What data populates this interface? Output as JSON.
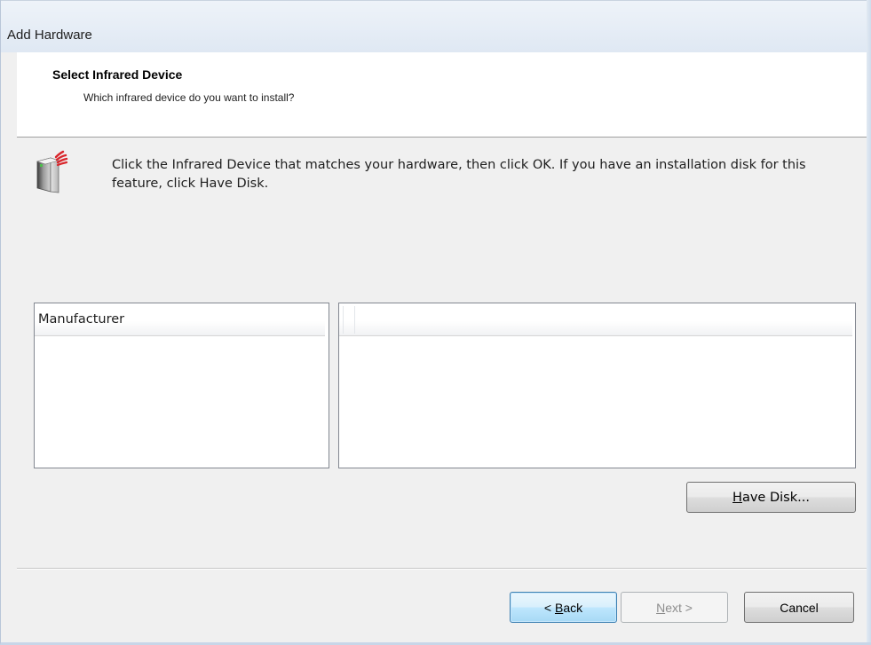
{
  "window": {
    "title": "Add Hardware"
  },
  "header": {
    "title": "Select Infrared Device",
    "subtitle": "Which infrared device do you want to install?"
  },
  "main": {
    "instruction": "Click the Infrared Device that matches your hardware, then click OK. If you have an installation disk for this feature, click Have Disk.",
    "device_icon": "infrared-device-icon",
    "manufacturer_list": {
      "header": "Manufacturer",
      "items": []
    },
    "model_list": {
      "header": "",
      "items": []
    },
    "have_disk": {
      "mnemonic": "H",
      "rest": "ave Disk..."
    }
  },
  "footer": {
    "back": {
      "prefix": "< ",
      "mnemonic": "B",
      "rest": "ack"
    },
    "next": {
      "mnemonic": "N",
      "rest": "ext >",
      "enabled": false
    },
    "cancel": {
      "label": "Cancel"
    }
  },
  "colors": {
    "dialog_background": "#f0f0f0",
    "header_background": "#ffffff",
    "default_button_border": "#3c7fb1",
    "infrared_signal": "#d9262c"
  }
}
